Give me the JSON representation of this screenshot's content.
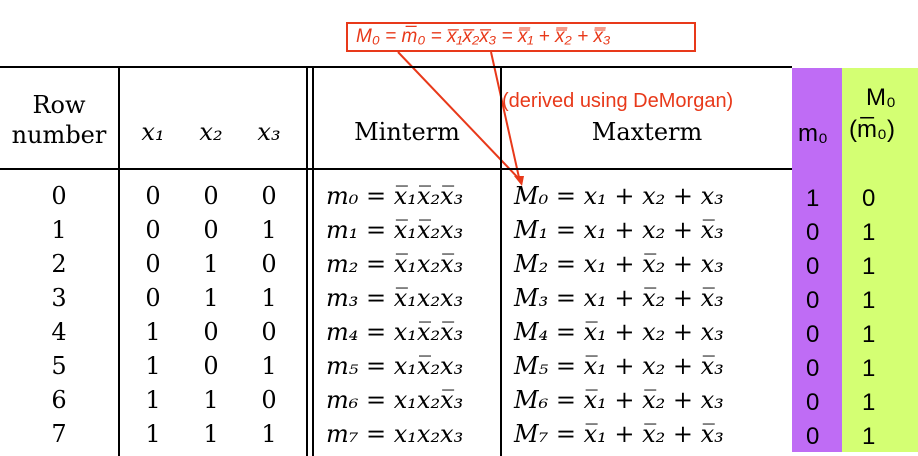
{
  "annotation": {
    "formula": "M₀ = m̅₀ = x̅₁x̅₂x̅₃ = x̿₁ + x̿₂ + x̿₃",
    "note": "(derived using DeMorgan)",
    "color": "#e8391a"
  },
  "headers": {
    "row_number": [
      "Row",
      "number"
    ],
    "x1": "x₁",
    "x2": "x₂",
    "x3": "x₃",
    "minterm": "Minterm",
    "maxterm": "Maxterm",
    "m0": "m₀",
    "M0": "M₀",
    "M0_sub": "(m̅₀)"
  },
  "colors": {
    "m_column": "#bf6cf5",
    "M_column": "#d4ff73"
  },
  "rows": [
    {
      "n": "0",
      "x1": "0",
      "x2": "0",
      "x3": "0",
      "minterm": "m₀ = x̅₁x̅₂x̅₃",
      "maxterm": "M₀ = x₁ + x₂ + x₃",
      "m": "1",
      "M": "0"
    },
    {
      "n": "1",
      "x1": "0",
      "x2": "0",
      "x3": "1",
      "minterm": "m₁ = x̅₁x̅₂x₃",
      "maxterm": "M₁ = x₁ + x₂ + x̅₃",
      "m": "0",
      "M": "1"
    },
    {
      "n": "2",
      "x1": "0",
      "x2": "1",
      "x3": "0",
      "minterm": "m₂ = x̅₁x₂x̅₃",
      "maxterm": "M₂ = x₁ + x̅₂ + x₃",
      "m": "0",
      "M": "1"
    },
    {
      "n": "3",
      "x1": "0",
      "x2": "1",
      "x3": "1",
      "minterm": "m₃ = x̅₁x₂x₃",
      "maxterm": "M₃ = x₁ + x̅₂ + x̅₃",
      "m": "0",
      "M": "1"
    },
    {
      "n": "4",
      "x1": "1",
      "x2": "0",
      "x3": "0",
      "minterm": "m₄ = x₁x̅₂x̅₃",
      "maxterm": "M₄ = x̅₁ + x₂ + x₃",
      "m": "0",
      "M": "1"
    },
    {
      "n": "5",
      "x1": "1",
      "x2": "0",
      "x3": "1",
      "minterm": "m₅ = x₁x̅₂x₃",
      "maxterm": "M₅ = x̅₁ + x₂ + x̅₃",
      "m": "0",
      "M": "1"
    },
    {
      "n": "6",
      "x1": "1",
      "x2": "1",
      "x3": "0",
      "minterm": "m₆ = x₁x₂x̅₃",
      "maxterm": "M₆ = x̅₁ + x̅₂ + x₃",
      "m": "0",
      "M": "1"
    },
    {
      "n": "7",
      "x1": "1",
      "x2": "1",
      "x3": "1",
      "minterm": "m₇ = x₁x₂x₃",
      "maxterm": "M₇ = x̅₁ + x̅₂ + x̅₃",
      "m": "0",
      "M": "1"
    }
  ]
}
